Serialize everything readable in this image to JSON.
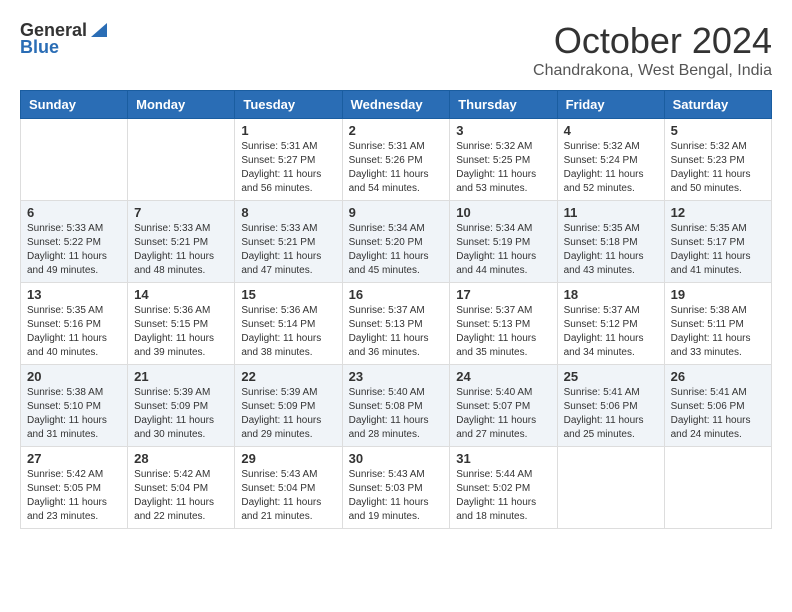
{
  "header": {
    "logo_general": "General",
    "logo_blue": "Blue",
    "month_title": "October 2024",
    "location": "Chandrakona, West Bengal, India"
  },
  "calendar": {
    "weekdays": [
      "Sunday",
      "Monday",
      "Tuesday",
      "Wednesday",
      "Thursday",
      "Friday",
      "Saturday"
    ],
    "weeks": [
      [
        {
          "day": "",
          "info": ""
        },
        {
          "day": "",
          "info": ""
        },
        {
          "day": "1",
          "info": "Sunrise: 5:31 AM\nSunset: 5:27 PM\nDaylight: 11 hours and 56 minutes."
        },
        {
          "day": "2",
          "info": "Sunrise: 5:31 AM\nSunset: 5:26 PM\nDaylight: 11 hours and 54 minutes."
        },
        {
          "day": "3",
          "info": "Sunrise: 5:32 AM\nSunset: 5:25 PM\nDaylight: 11 hours and 53 minutes."
        },
        {
          "day": "4",
          "info": "Sunrise: 5:32 AM\nSunset: 5:24 PM\nDaylight: 11 hours and 52 minutes."
        },
        {
          "day": "5",
          "info": "Sunrise: 5:32 AM\nSunset: 5:23 PM\nDaylight: 11 hours and 50 minutes."
        }
      ],
      [
        {
          "day": "6",
          "info": "Sunrise: 5:33 AM\nSunset: 5:22 PM\nDaylight: 11 hours and 49 minutes."
        },
        {
          "day": "7",
          "info": "Sunrise: 5:33 AM\nSunset: 5:21 PM\nDaylight: 11 hours and 48 minutes."
        },
        {
          "day": "8",
          "info": "Sunrise: 5:33 AM\nSunset: 5:21 PM\nDaylight: 11 hours and 47 minutes."
        },
        {
          "day": "9",
          "info": "Sunrise: 5:34 AM\nSunset: 5:20 PM\nDaylight: 11 hours and 45 minutes."
        },
        {
          "day": "10",
          "info": "Sunrise: 5:34 AM\nSunset: 5:19 PM\nDaylight: 11 hours and 44 minutes."
        },
        {
          "day": "11",
          "info": "Sunrise: 5:35 AM\nSunset: 5:18 PM\nDaylight: 11 hours and 43 minutes."
        },
        {
          "day": "12",
          "info": "Sunrise: 5:35 AM\nSunset: 5:17 PM\nDaylight: 11 hours and 41 minutes."
        }
      ],
      [
        {
          "day": "13",
          "info": "Sunrise: 5:35 AM\nSunset: 5:16 PM\nDaylight: 11 hours and 40 minutes."
        },
        {
          "day": "14",
          "info": "Sunrise: 5:36 AM\nSunset: 5:15 PM\nDaylight: 11 hours and 39 minutes."
        },
        {
          "day": "15",
          "info": "Sunrise: 5:36 AM\nSunset: 5:14 PM\nDaylight: 11 hours and 38 minutes."
        },
        {
          "day": "16",
          "info": "Sunrise: 5:37 AM\nSunset: 5:13 PM\nDaylight: 11 hours and 36 minutes."
        },
        {
          "day": "17",
          "info": "Sunrise: 5:37 AM\nSunset: 5:13 PM\nDaylight: 11 hours and 35 minutes."
        },
        {
          "day": "18",
          "info": "Sunrise: 5:37 AM\nSunset: 5:12 PM\nDaylight: 11 hours and 34 minutes."
        },
        {
          "day": "19",
          "info": "Sunrise: 5:38 AM\nSunset: 5:11 PM\nDaylight: 11 hours and 33 minutes."
        }
      ],
      [
        {
          "day": "20",
          "info": "Sunrise: 5:38 AM\nSunset: 5:10 PM\nDaylight: 11 hours and 31 minutes."
        },
        {
          "day": "21",
          "info": "Sunrise: 5:39 AM\nSunset: 5:09 PM\nDaylight: 11 hours and 30 minutes."
        },
        {
          "day": "22",
          "info": "Sunrise: 5:39 AM\nSunset: 5:09 PM\nDaylight: 11 hours and 29 minutes."
        },
        {
          "day": "23",
          "info": "Sunrise: 5:40 AM\nSunset: 5:08 PM\nDaylight: 11 hours and 28 minutes."
        },
        {
          "day": "24",
          "info": "Sunrise: 5:40 AM\nSunset: 5:07 PM\nDaylight: 11 hours and 27 minutes."
        },
        {
          "day": "25",
          "info": "Sunrise: 5:41 AM\nSunset: 5:06 PM\nDaylight: 11 hours and 25 minutes."
        },
        {
          "day": "26",
          "info": "Sunrise: 5:41 AM\nSunset: 5:06 PM\nDaylight: 11 hours and 24 minutes."
        }
      ],
      [
        {
          "day": "27",
          "info": "Sunrise: 5:42 AM\nSunset: 5:05 PM\nDaylight: 11 hours and 23 minutes."
        },
        {
          "day": "28",
          "info": "Sunrise: 5:42 AM\nSunset: 5:04 PM\nDaylight: 11 hours and 22 minutes."
        },
        {
          "day": "29",
          "info": "Sunrise: 5:43 AM\nSunset: 5:04 PM\nDaylight: 11 hours and 21 minutes."
        },
        {
          "day": "30",
          "info": "Sunrise: 5:43 AM\nSunset: 5:03 PM\nDaylight: 11 hours and 19 minutes."
        },
        {
          "day": "31",
          "info": "Sunrise: 5:44 AM\nSunset: 5:02 PM\nDaylight: 11 hours and 18 minutes."
        },
        {
          "day": "",
          "info": ""
        },
        {
          "day": "",
          "info": ""
        }
      ]
    ]
  }
}
